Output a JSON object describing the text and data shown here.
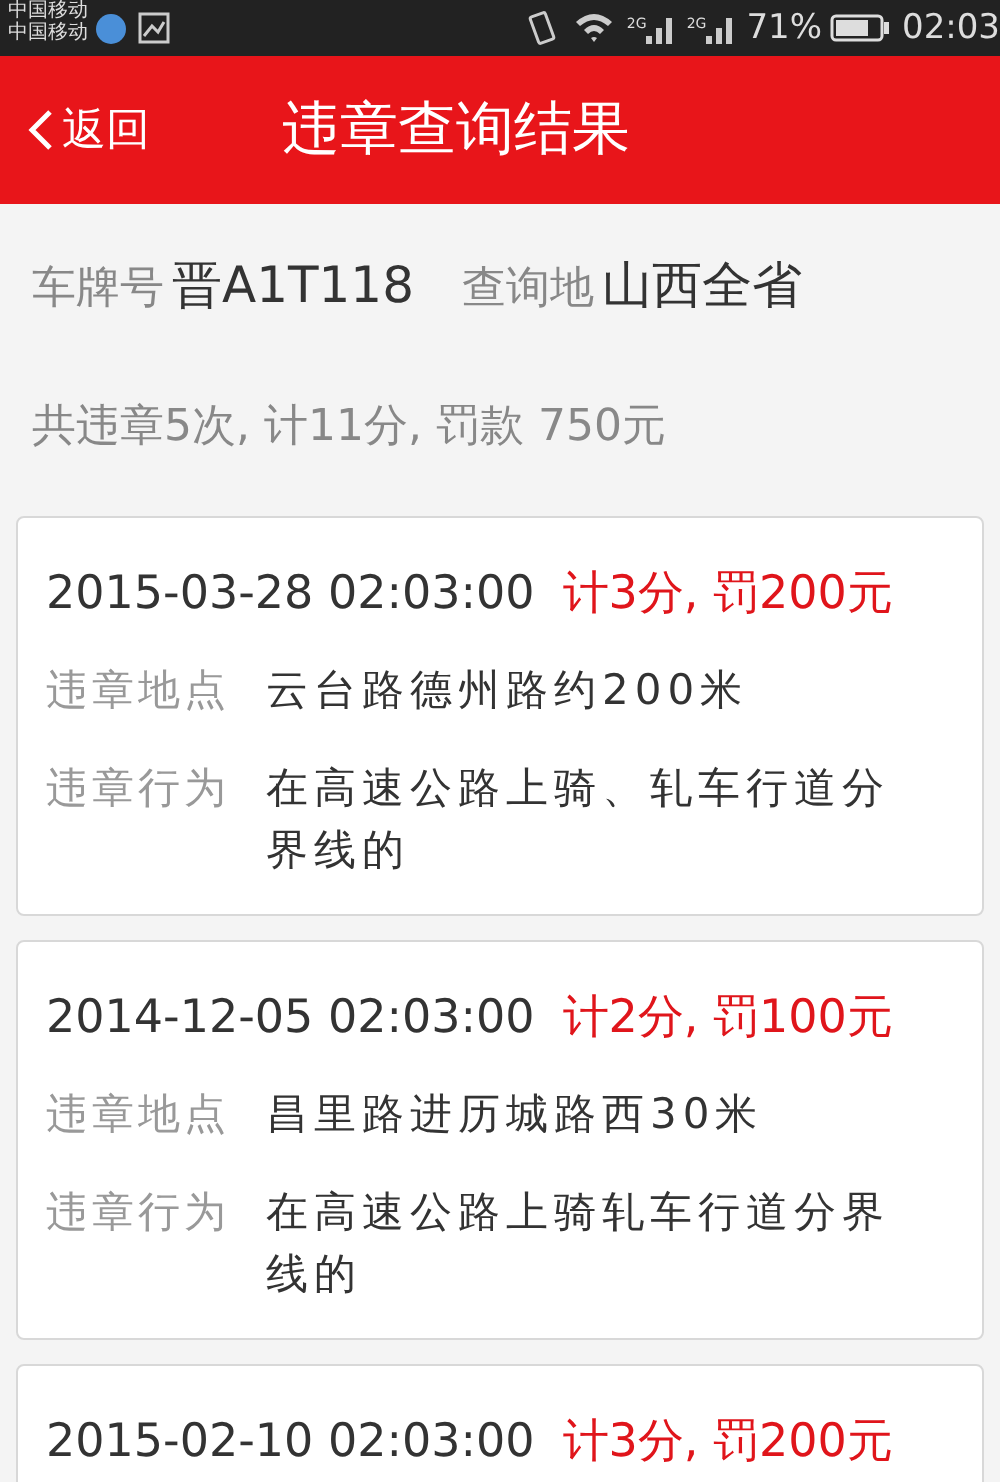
{
  "status_bar": {
    "carriers": [
      "中国移动",
      "中国移动"
    ],
    "network_labels": [
      "2G",
      "2G"
    ],
    "battery": "71%",
    "time": "02:03"
  },
  "header": {
    "back": "返回",
    "title": "违章查询结果"
  },
  "query": {
    "plate_label": "车牌号",
    "plate": "晋A1T118",
    "region_label": "查询地",
    "region": "山西全省"
  },
  "summary": "共违章5次, 计11分, 罚款 750元",
  "records": [
    {
      "time": "2015-03-28 02:03:00",
      "penalty": "计3分, 罚200元",
      "details": [
        {
          "label": "违章地点",
          "value": "云台路德州路约200米"
        },
        {
          "label": "违章行为",
          "value": "在高速公路上骑、轧车行道分界线的"
        }
      ]
    },
    {
      "time": "2014-12-05 02:03:00",
      "penalty": "计2分, 罚100元",
      "details": [
        {
          "label": "违章地点",
          "value": "昌里路进历城路西30米"
        },
        {
          "label": "违章行为",
          "value": "在高速公路上骑轧车行道分界线的"
        }
      ]
    },
    {
      "time": "2015-02-10 02:03:00",
      "penalty": "计3分, 罚200元"
    }
  ]
}
